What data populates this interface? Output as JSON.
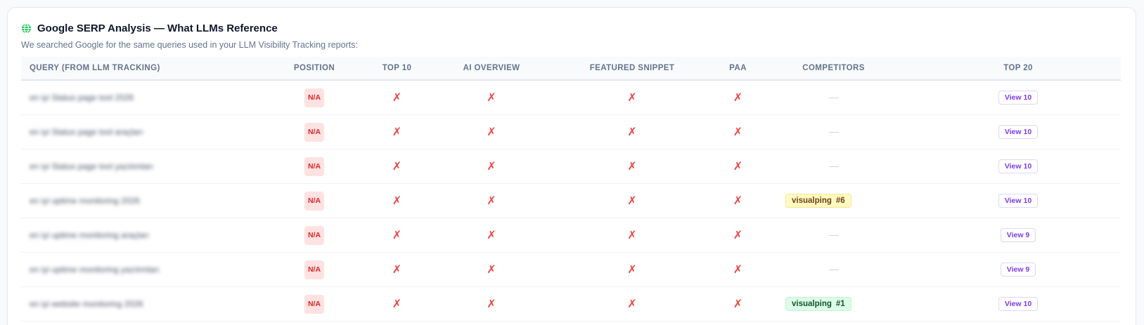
{
  "header": {
    "icon": "globe-icon",
    "title": "Google SERP Analysis — What LLMs Reference",
    "subtitle": "We searched Google for the same queries used in your LLM Visibility Tracking reports:"
  },
  "table": {
    "columns": [
      "Query (from LLM Tracking)",
      "Position",
      "Top 10",
      "AI Overview",
      "Featured Snippet",
      "PAA",
      "Competitors",
      "Top 20"
    ],
    "rows": [
      {
        "query": "en iyi Status page tool 2026",
        "position": "N/A",
        "top10": "✗",
        "ai_overview": "✗",
        "featured_snippet": "✗",
        "paa": "✗",
        "competitor": null,
        "competitor_rank": null,
        "top20": "View 10"
      },
      {
        "query": "en iyi Status page tool araçları",
        "position": "N/A",
        "top10": "✗",
        "ai_overview": "✗",
        "featured_snippet": "✗",
        "paa": "✗",
        "competitor": null,
        "competitor_rank": null,
        "top20": "View 10"
      },
      {
        "query": "en iyi Status page tool yazılımları",
        "position": "N/A",
        "top10": "✗",
        "ai_overview": "✗",
        "featured_snippet": "✗",
        "paa": "✗",
        "competitor": null,
        "competitor_rank": null,
        "top20": "View 10"
      },
      {
        "query": "en iyi uptime monitoring 2026",
        "position": "N/A",
        "top10": "✗",
        "ai_overview": "✗",
        "featured_snippet": "✗",
        "paa": "✗",
        "competitor": "visualping",
        "competitor_rank": "#6",
        "competitor_color": "yellow",
        "top20": "View 10"
      },
      {
        "query": "en iyi uptime monitoring araçları",
        "position": "N/A",
        "top10": "✗",
        "ai_overview": "✗",
        "featured_snippet": "✗",
        "paa": "✗",
        "competitor": null,
        "competitor_rank": null,
        "top20": "View 9"
      },
      {
        "query": "en iyi uptime monitoring yazılımları",
        "position": "N/A",
        "top10": "✗",
        "ai_overview": "✗",
        "featured_snippet": "✗",
        "paa": "✗",
        "competitor": null,
        "competitor_rank": null,
        "top20": "View 9"
      },
      {
        "query": "en iyi website monitoring 2026",
        "position": "N/A",
        "top10": "✗",
        "ai_overview": "✗",
        "featured_snippet": "✗",
        "paa": "✗",
        "competitor": "visualping",
        "competitor_rank": "#1",
        "competitor_color": "green",
        "top20": "View 10"
      }
    ]
  }
}
